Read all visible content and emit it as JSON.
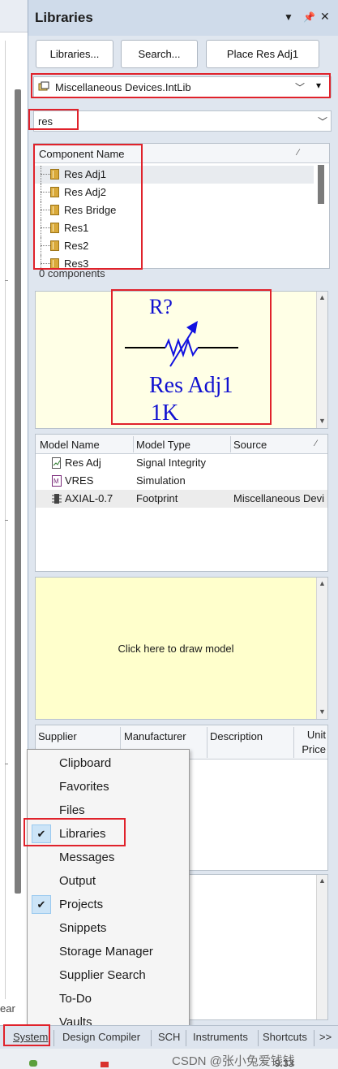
{
  "left_edge": {
    "partial_label": "ear"
  },
  "panel": {
    "title": "Libraries",
    "title_icons": [
      "dropdown-triangle-icon",
      "pin-icon",
      "close-icon"
    ],
    "buttons": {
      "libraries": "Libraries...",
      "search": "Search...",
      "place": "Place Res Adj1"
    },
    "library_select": {
      "value": "Miscellaneous Devices.IntLib"
    },
    "filter": {
      "value": "res"
    },
    "components": {
      "header": "Component Name",
      "items": [
        "Res Adj1",
        "Res Adj2",
        "Res Bridge",
        "Res1",
        "Res2",
        "Res3"
      ],
      "selected_index": 0,
      "count_text": "0 components"
    },
    "preview": {
      "designator": "R?",
      "name": "Res Adj1",
      "value": "1K"
    },
    "models": {
      "headers": [
        "Model Name",
        "Model Type",
        "Source"
      ],
      "rows": [
        {
          "name": "Res Adj",
          "type": "Signal Integrity",
          "source": "",
          "icon": "signal-integrity-icon"
        },
        {
          "name": "VRES",
          "type": "Simulation",
          "source": "",
          "icon": "simulation-icon"
        },
        {
          "name": "AXIAL-0.7",
          "type": "Footprint",
          "source": "Miscellaneous Devi",
          "icon": "footprint-icon"
        }
      ]
    },
    "draw_model_text": "Click here to draw model",
    "suppliers": {
      "headers": [
        "Supplier",
        "Manufacturer",
        "Description",
        "Unit Price"
      ]
    }
  },
  "popup_menu": {
    "items": [
      {
        "label": "Clipboard",
        "checked": false
      },
      {
        "label": "Favorites",
        "checked": false
      },
      {
        "label": "Files",
        "checked": false
      },
      {
        "label": "Libraries",
        "checked": true
      },
      {
        "label": "Messages",
        "checked": false
      },
      {
        "label": "Output",
        "checked": false
      },
      {
        "label": "Projects",
        "checked": true
      },
      {
        "label": "Snippets",
        "checked": false
      },
      {
        "label": "Storage Manager",
        "checked": false
      },
      {
        "label": "Supplier Search",
        "checked": false
      },
      {
        "label": "To-Do",
        "checked": false
      },
      {
        "label": "Vaults",
        "checked": false
      }
    ]
  },
  "tabs": [
    "System",
    "Design Compiler",
    "SCH",
    "Instruments",
    "Shortcuts",
    ">>"
  ],
  "status": {
    "watermark": "CSDN @张小兔爱钱钱",
    "time": "9:33"
  },
  "colors": {
    "highlight_red": "#e0222b",
    "preview_bg": "#ffffe6",
    "draw_model_bg": "#ffffcc",
    "symbol_blue": "#1010e0"
  }
}
